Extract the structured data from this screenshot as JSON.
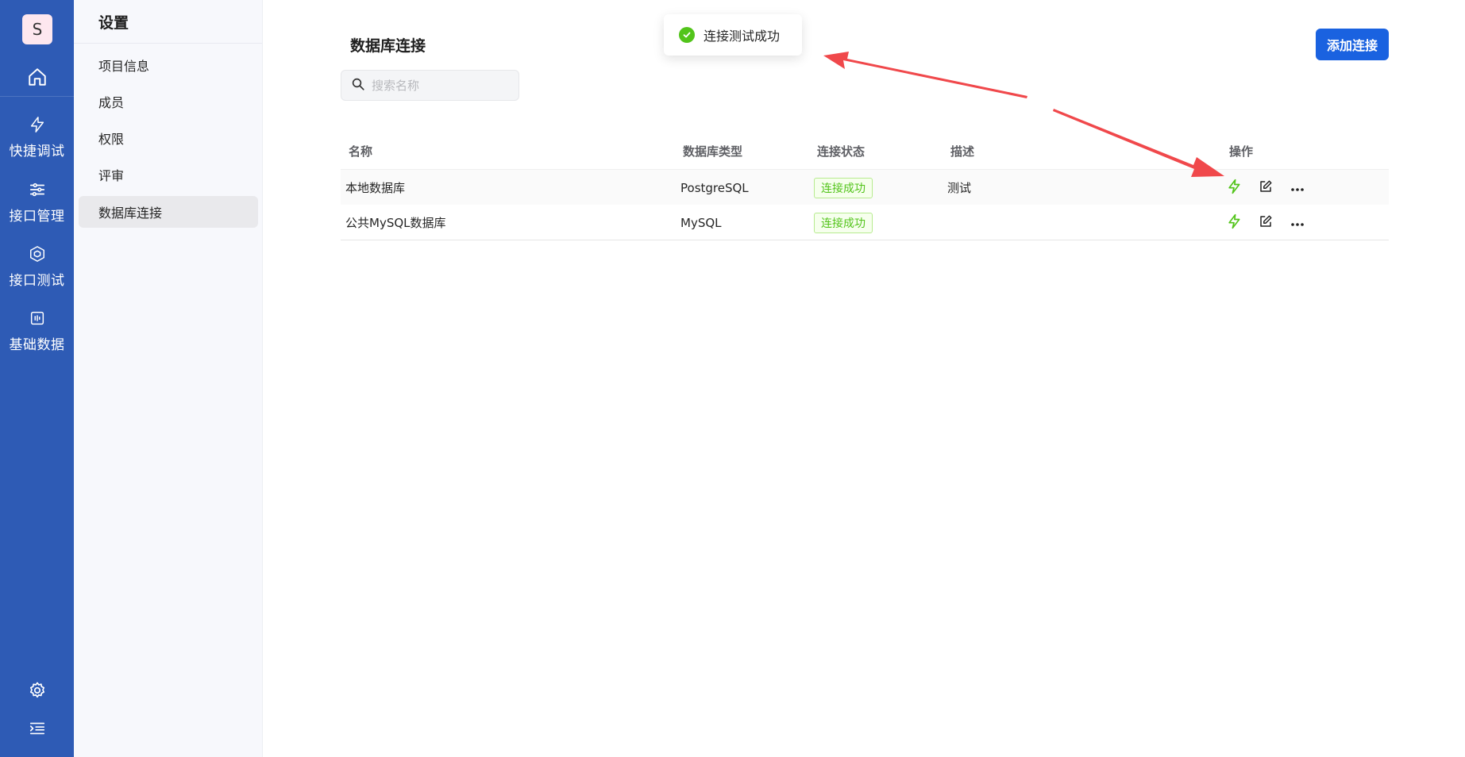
{
  "rail": {
    "avatar_letter": "S",
    "items": [
      {
        "label": "快捷调试",
        "icon": "lightning-icon"
      },
      {
        "label": "接口管理",
        "icon": "sliders-icon"
      },
      {
        "label": "接口测试",
        "icon": "cube-icon"
      },
      {
        "label": "基础数据",
        "icon": "data-icon"
      }
    ],
    "bottom": [
      "gear-icon",
      "collapse-menu-icon"
    ]
  },
  "sidebar": {
    "title": "设置",
    "items": [
      {
        "label": "项目信息"
      },
      {
        "label": "成员"
      },
      {
        "label": "权限"
      },
      {
        "label": "评审"
      },
      {
        "label": "数据库连接",
        "active": true
      }
    ]
  },
  "main": {
    "title": "数据库连接",
    "add_button": "添加连接",
    "search_placeholder": "搜索名称",
    "columns": [
      "名称",
      "数据库类型",
      "连接状态",
      "描述",
      "操作"
    ],
    "rows": [
      {
        "name": "本地数据库",
        "type": "PostgreSQL",
        "status": "连接成功",
        "desc": "测试"
      },
      {
        "name": "公共MySQL数据库",
        "type": "MySQL",
        "status": "连接成功",
        "desc": ""
      }
    ]
  },
  "toast": {
    "text": "连接测试成功",
    "icon": "check-circle-icon"
  },
  "colors": {
    "rail_bg": "#2e5bb5",
    "primary": "#1a62e0",
    "success": "#52c41a",
    "annotation": "#f0484b"
  }
}
